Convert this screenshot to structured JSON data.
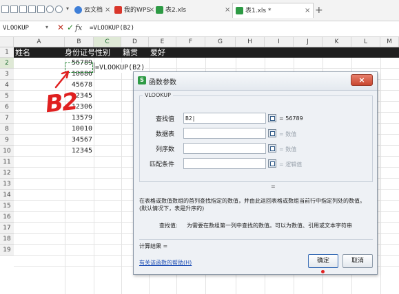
{
  "tabs": [
    {
      "label": "云文档",
      "active": false
    },
    {
      "label": "我的WPS",
      "active": false
    },
    {
      "label": "表2.xls",
      "active": false
    },
    {
      "label": "表1.xls *",
      "active": true
    }
  ],
  "new_tab_symbol": "+",
  "close_symbol": "×",
  "formula_bar": {
    "name_box": "VLOOKUP",
    "cancel_symbol": "✕",
    "ok_symbol": "✓",
    "fx_label": "fx",
    "formula": "=VLOOKUP(B2)"
  },
  "columns": [
    "A",
    "B",
    "C",
    "D",
    "E",
    "F",
    "G",
    "H",
    "I",
    "J",
    "K",
    "L",
    "M"
  ],
  "rows": [
    "1",
    "2",
    "3",
    "4",
    "5",
    "6",
    "7",
    "8",
    "9",
    "10",
    "11",
    "12",
    "13",
    "14",
    "15",
    "16",
    "17",
    "18",
    "19"
  ],
  "header_row": {
    "a": "姓名",
    "b": "身份证号",
    "c": "性别",
    "d": "籍贯",
    "e": "爱好"
  },
  "id_values": [
    "56789",
    "10086",
    "45678",
    "12345",
    "12306",
    "13579",
    "10010",
    "34567",
    "12345"
  ],
  "editing_cell_text": "=VLOOKUP(B2)",
  "annotation": "B2",
  "dialog": {
    "title": "函数参数",
    "close_symbol": "×",
    "function_name": "VLOOKUP",
    "args": [
      {
        "label": "查找值",
        "value": "B2|",
        "result": "= 56789",
        "gray": false
      },
      {
        "label": "数据表",
        "value": "",
        "result": "= 数值",
        "gray": true
      },
      {
        "label": "列序数",
        "value": "",
        "result": "= 数值",
        "gray": true
      },
      {
        "label": "匹配条件",
        "value": "",
        "result": "= 逻辑值",
        "gray": true
      }
    ],
    "result_eq": "=",
    "description": "在表格或数值数组的首列查找指定的数值，并由此返回表格或数组当前行中指定列处的数值。(默认情况下，表是升序的)",
    "arg_desc_name": "查找值:",
    "arg_desc": "为需要在数组第一列中查找的数值。可以为数值、引用或文本字符串",
    "calc_result": "计算结果 =",
    "help_link": "有关该函数的帮助(H)",
    "ok_label": "确定",
    "cancel_label": "取消"
  },
  "colors": {
    "accent": "#2d9a44",
    "annotation": "#e02020"
  }
}
